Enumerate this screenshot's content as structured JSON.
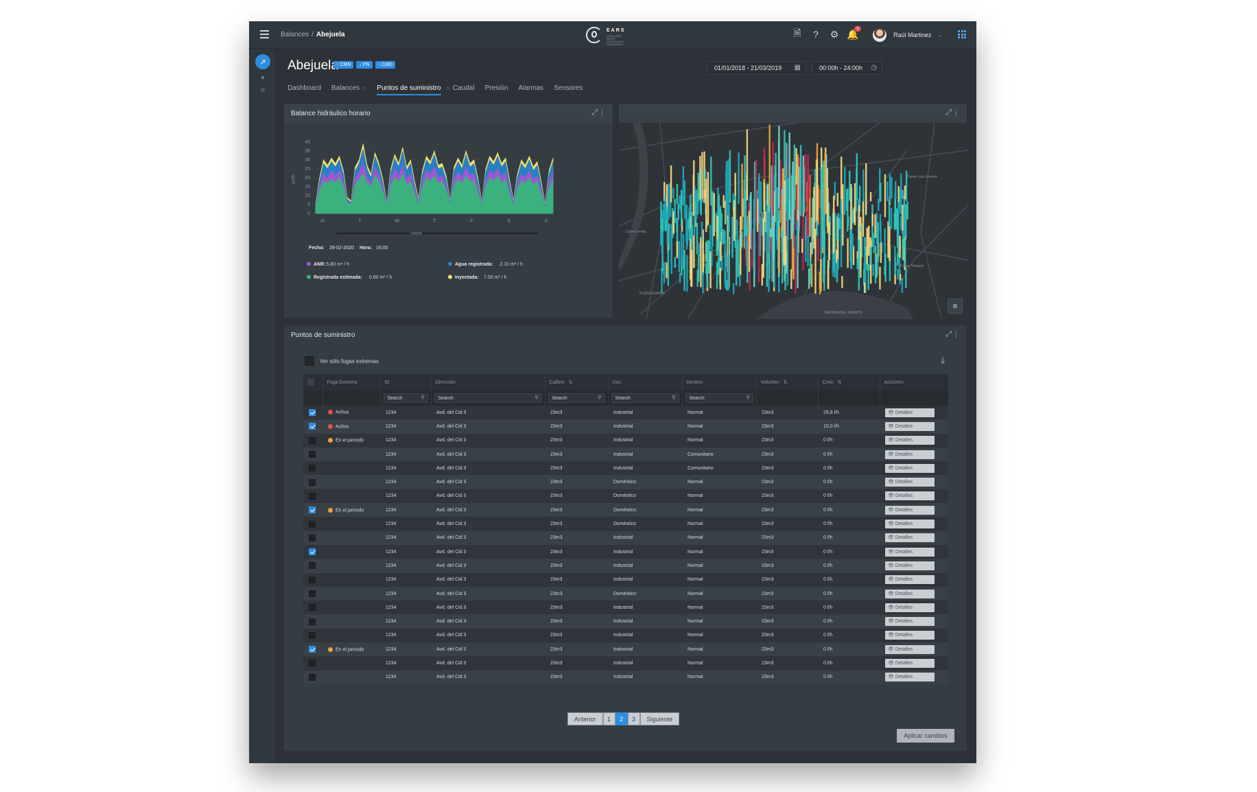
{
  "topbar": {
    "breadcrumb_parent": "Balances",
    "breadcrumb_sep": "/",
    "breadcrumb_current": "Abejuela",
    "logo_name": "EARS",
    "logo_tagline": "INTELLIGENT WATER DISTRIBUTION MANAGEMENT",
    "notification_count": "1",
    "user_name": "Raúl Martinez"
  },
  "header": {
    "title": "Abejuela",
    "badges": [
      "↑ CMN",
      "↓ PN",
      "↑ CMD"
    ],
    "tabs": [
      "Dashboard",
      "Balances",
      "Puntos de suministro",
      "Caudal",
      "Presión",
      "Alarmas",
      "Sensores"
    ],
    "active_tab": 2,
    "date_range": "01/01/2018 - 21/03/2019",
    "time_range": "00:00h - 24:00h"
  },
  "chart_panel": {
    "title": "Balance hidráulico horario",
    "fecha_label": "Fecha:",
    "fecha_value": "28-02-2020",
    "hora_label": "Hora:",
    "hora_value": "16:00",
    "legend": [
      {
        "label": "ANR:",
        "value": "5.80 m³ / h",
        "color": "#9b59d0"
      },
      {
        "label": "Agua registrada:",
        "value": "2.10 m³ / h",
        "color": "#2a7fc4"
      },
      {
        "label": "Registrada estimada:",
        "value": "0.80 m³ / h",
        "color": "#3bb27d"
      },
      {
        "label": "Inyectada:",
        "value": "7.50 m³ / h",
        "color": "#f0e06a"
      }
    ]
  },
  "chart_data": {
    "type": "area",
    "title": "Balance hidráulico horario",
    "xlabel": "",
    "ylabel": "m³/h",
    "ylim": [
      0,
      40
    ],
    "yticks": [
      0,
      5,
      10,
      15,
      20,
      25,
      30,
      35,
      40
    ],
    "x_ticks": [
      "M",
      "T",
      "W",
      "T",
      "F",
      "S",
      "S"
    ],
    "series": [
      {
        "name": "Inyectada",
        "color": "#f0e06a",
        "values": [
          5,
          20,
          30,
          27,
          31,
          28,
          32,
          24,
          9,
          7,
          26,
          30,
          39,
          27,
          22,
          34,
          28,
          19,
          6,
          25,
          33,
          28,
          37,
          26,
          30,
          18,
          8,
          24,
          32,
          29,
          35,
          27,
          28,
          21,
          7,
          26,
          31,
          27,
          35,
          28,
          30,
          20,
          6,
          25,
          32,
          29,
          34,
          28,
          31,
          19,
          7,
          22,
          30,
          27,
          32,
          26,
          29,
          18,
          5,
          24,
          31
        ]
      },
      {
        "name": "Agua registrada",
        "color": "#2a7fc4",
        "values": [
          4,
          18,
          28,
          25,
          29,
          26,
          30,
          22,
          8,
          6,
          24,
          28,
          36,
          25,
          20,
          32,
          26,
          17,
          5,
          23,
          31,
          26,
          35,
          24,
          28,
          16,
          7,
          22,
          30,
          27,
          33,
          25,
          26,
          19,
          6,
          24,
          29,
          25,
          33,
          26,
          28,
          18,
          5,
          23,
          30,
          27,
          32,
          26,
          29,
          17,
          6,
          20,
          28,
          25,
          30,
          24,
          27,
          16,
          4,
          22,
          29
        ]
      },
      {
        "name": "ANR",
        "color": "#9b59d0",
        "values": [
          3,
          15,
          22,
          20,
          24,
          21,
          24,
          18,
          7,
          5,
          19,
          23,
          28,
          20,
          17,
          26,
          21,
          14,
          4,
          19,
          25,
          21,
          27,
          19,
          22,
          13,
          6,
          18,
          24,
          22,
          26,
          20,
          21,
          15,
          5,
          19,
          23,
          20,
          26,
          21,
          22,
          14,
          4,
          18,
          24,
          22,
          25,
          20,
          23,
          13,
          5,
          16,
          22,
          20,
          24,
          19,
          21,
          13,
          3,
          17,
          23
        ]
      },
      {
        "name": "Registrada estimada",
        "color": "#3bb27d",
        "values": [
          3,
          13,
          18,
          17,
          19,
          17,
          20,
          15,
          6,
          5,
          16,
          19,
          22,
          17,
          15,
          21,
          18,
          12,
          4,
          16,
          20,
          18,
          22,
          16,
          18,
          11,
          5,
          15,
          20,
          18,
          21,
          17,
          18,
          13,
          5,
          16,
          19,
          17,
          21,
          18,
          18,
          12,
          4,
          15,
          20,
          18,
          21,
          17,
          19,
          11,
          4,
          14,
          18,
          17,
          20,
          16,
          18,
          11,
          3,
          14,
          19
        ]
      }
    ],
    "grid": true
  },
  "map_panel": {
    "map_labels": [
      "PLAZA ESPAÑA",
      "AVENIDA DEL PUERTO",
      "Carrer Luis Llorente",
      "Carrer Lerida",
      "Carrer Trinquet"
    ]
  },
  "table_panel": {
    "title": "Puntos de suministro",
    "toggle_label": "Ver sólo fugas extremas",
    "columns": [
      "Fuga Extrema",
      "ID",
      "Dirección",
      "Calibre",
      "Uso",
      "Destino",
      "Volumen",
      "Cmin",
      "Acciones"
    ],
    "search_placeholder": "Search",
    "rows": [
      {
        "checked": true,
        "fuga": "Activa",
        "fuga_color": "#e0524f",
        "id": "1234",
        "dir": "Avd. del Cid 3",
        "calibre": "23m3",
        "uso": "Industrial",
        "destino": "Normal",
        "volumen": "23m3",
        "cmin": "29,8 l/h"
      },
      {
        "checked": true,
        "fuga": "Activa",
        "fuga_color": "#e0524f",
        "id": "1234",
        "dir": "Avd. del Cid 3",
        "calibre": "23m3",
        "uso": "Industrial",
        "destino": "Normal",
        "volumen": "23m3",
        "cmin": "10,0 l/h"
      },
      {
        "checked": false,
        "fuga": "En el periodo",
        "fuga_color": "#f0a03c",
        "id": "1234",
        "dir": "Avd. del Cid 3",
        "calibre": "23m3",
        "uso": "Industrial",
        "destino": "Normal",
        "volumen": "23m3",
        "cmin": "0 l/h"
      },
      {
        "checked": false,
        "fuga": "",
        "fuga_color": "",
        "id": "1234",
        "dir": "Avd. del Cid 3",
        "calibre": "23m3",
        "uso": "Industrial",
        "destino": "Comunitario",
        "volumen": "23m3",
        "cmin": "0 l/h"
      },
      {
        "checked": false,
        "fuga": "",
        "fuga_color": "",
        "id": "1234",
        "dir": "Avd. del Cid 3",
        "calibre": "23m3",
        "uso": "Industrial",
        "destino": "Comunitario",
        "volumen": "23m3",
        "cmin": "0 l/h"
      },
      {
        "checked": false,
        "fuga": "",
        "fuga_color": "",
        "id": "1234",
        "dir": "Avd. del Cid 3",
        "calibre": "23m3",
        "uso": "Doméstico",
        "destino": "Normal",
        "volumen": "23m3",
        "cmin": "0 l/h"
      },
      {
        "checked": false,
        "fuga": "",
        "fuga_color": "",
        "id": "1234",
        "dir": "Avd. del Cid 3",
        "calibre": "23m3",
        "uso": "Doméstico",
        "destino": "Normal",
        "volumen": "23m3",
        "cmin": "0 l/h"
      },
      {
        "checked": true,
        "fuga": "En el periodo",
        "fuga_color": "#f0a03c",
        "id": "1234",
        "dir": "Avd. del Cid 3",
        "calibre": "23m3",
        "uso": "Doméstico",
        "destino": "Normal",
        "volumen": "23m3",
        "cmin": "0 l/h"
      },
      {
        "checked": false,
        "fuga": "",
        "fuga_color": "",
        "id": "1234",
        "dir": "Avd. del Cid 3",
        "calibre": "23m3",
        "uso": "Doméstico",
        "destino": "Normal",
        "volumen": "23m3",
        "cmin": "0 l/h"
      },
      {
        "checked": false,
        "fuga": "",
        "fuga_color": "",
        "id": "1234",
        "dir": "Avd. del Cid 3",
        "calibre": "23m3",
        "uso": "Industrial",
        "destino": "Normal",
        "volumen": "23m3",
        "cmin": "0 l/h"
      },
      {
        "checked": true,
        "fuga": "",
        "fuga_color": "",
        "id": "1234",
        "dir": "Avd. del Cid 3",
        "calibre": "23m3",
        "uso": "Industrial",
        "destino": "Normal",
        "volumen": "23m3",
        "cmin": "0 l/h"
      },
      {
        "checked": false,
        "fuga": "",
        "fuga_color": "",
        "id": "1234",
        "dir": "Avd. del Cid 3",
        "calibre": "23m3",
        "uso": "Industrial",
        "destino": "Normal",
        "volumen": "23m3",
        "cmin": "0 l/h"
      },
      {
        "checked": false,
        "fuga": "",
        "fuga_color": "",
        "id": "1234",
        "dir": "Avd. del Cid 3",
        "calibre": "23m3",
        "uso": "Industrial",
        "destino": "Normal",
        "volumen": "23m3",
        "cmin": "0 l/h"
      },
      {
        "checked": false,
        "fuga": "",
        "fuga_color": "",
        "id": "1234",
        "dir": "Avd. del Cid 3",
        "calibre": "23m3",
        "uso": "Doméstico",
        "destino": "Normal",
        "volumen": "23m3",
        "cmin": "0 l/h"
      },
      {
        "checked": false,
        "fuga": "",
        "fuga_color": "",
        "id": "1234",
        "dir": "Avd. del Cid 3",
        "calibre": "23m3",
        "uso": "Industrial",
        "destino": "Normal",
        "volumen": "23m3",
        "cmin": "0 l/h"
      },
      {
        "checked": false,
        "fuga": "",
        "fuga_color": "",
        "id": "1234",
        "dir": "Avd. del Cid 3",
        "calibre": "23m3",
        "uso": "Industrial",
        "destino": "Normal",
        "volumen": "23m3",
        "cmin": "0 l/h"
      },
      {
        "checked": false,
        "fuga": "",
        "fuga_color": "",
        "id": "1234",
        "dir": "Avd. del Cid 3",
        "calibre": "23m3",
        "uso": "Industrial",
        "destino": "Normal",
        "volumen": "23m3",
        "cmin": "0 l/h"
      },
      {
        "checked": true,
        "fuga": "En el periodo",
        "fuga_color": "#f0a03c",
        "id": "1234",
        "dir": "Avd. del Cid 3",
        "calibre": "23m3",
        "uso": "Industrial",
        "destino": "Normal",
        "volumen": "23m3",
        "cmin": "0 l/h"
      },
      {
        "checked": false,
        "fuga": "",
        "fuga_color": "",
        "id": "1234",
        "dir": "Avd. del Cid 3",
        "calibre": "23m3",
        "uso": "Industrial",
        "destino": "Normal",
        "volumen": "23m3",
        "cmin": "0 l/h"
      },
      {
        "checked": false,
        "fuga": "",
        "fuga_color": "",
        "id": "1234",
        "dir": "Avd. del Cid 3",
        "calibre": "23m3",
        "uso": "Industrial",
        "destino": "Normal",
        "volumen": "23m3",
        "cmin": "0 l/h"
      }
    ],
    "details_label": "Detalles",
    "pager": {
      "prev": "Anterior",
      "pages": [
        "1",
        "2",
        "3"
      ],
      "current": 1,
      "next": "Siguiente"
    },
    "apply_label": "Aplicar cambios"
  },
  "colors": {
    "accent": "#2f8ee0",
    "bg": "#2c3237",
    "panel": "#353c42",
    "danger": "#e0524f",
    "warning": "#f0a03c"
  }
}
